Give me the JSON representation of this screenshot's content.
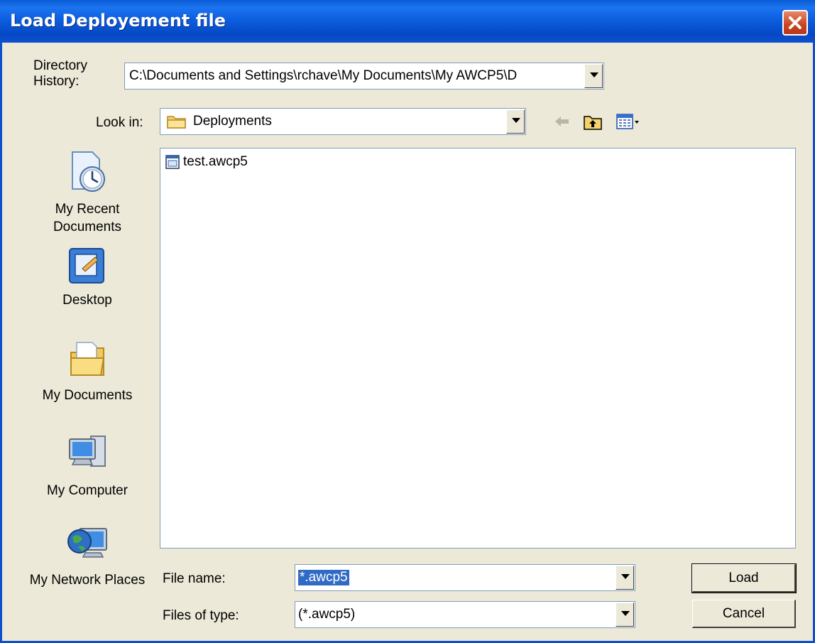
{
  "window": {
    "title": "Load Deployement file"
  },
  "directory_history": {
    "label": "Directory History:",
    "value": "C:\\Documents and Settings\\rchave\\My Documents\\My AWCP5\\D"
  },
  "look_in": {
    "label": "Look in:",
    "value": "Deployments"
  },
  "files": [
    {
      "name": "test.awcp5"
    }
  ],
  "places": [
    {
      "label": "My Recent Documents"
    },
    {
      "label": "Desktop"
    },
    {
      "label": "My Documents"
    },
    {
      "label": "My Computer"
    },
    {
      "label": "My Network Places"
    }
  ],
  "file_name": {
    "label": "File name:",
    "value": "*.awcp5"
  },
  "file_type": {
    "label": "Files of type:",
    "value": "(*.awcp5)"
  },
  "buttons": {
    "load": "Load",
    "cancel": "Cancel"
  }
}
